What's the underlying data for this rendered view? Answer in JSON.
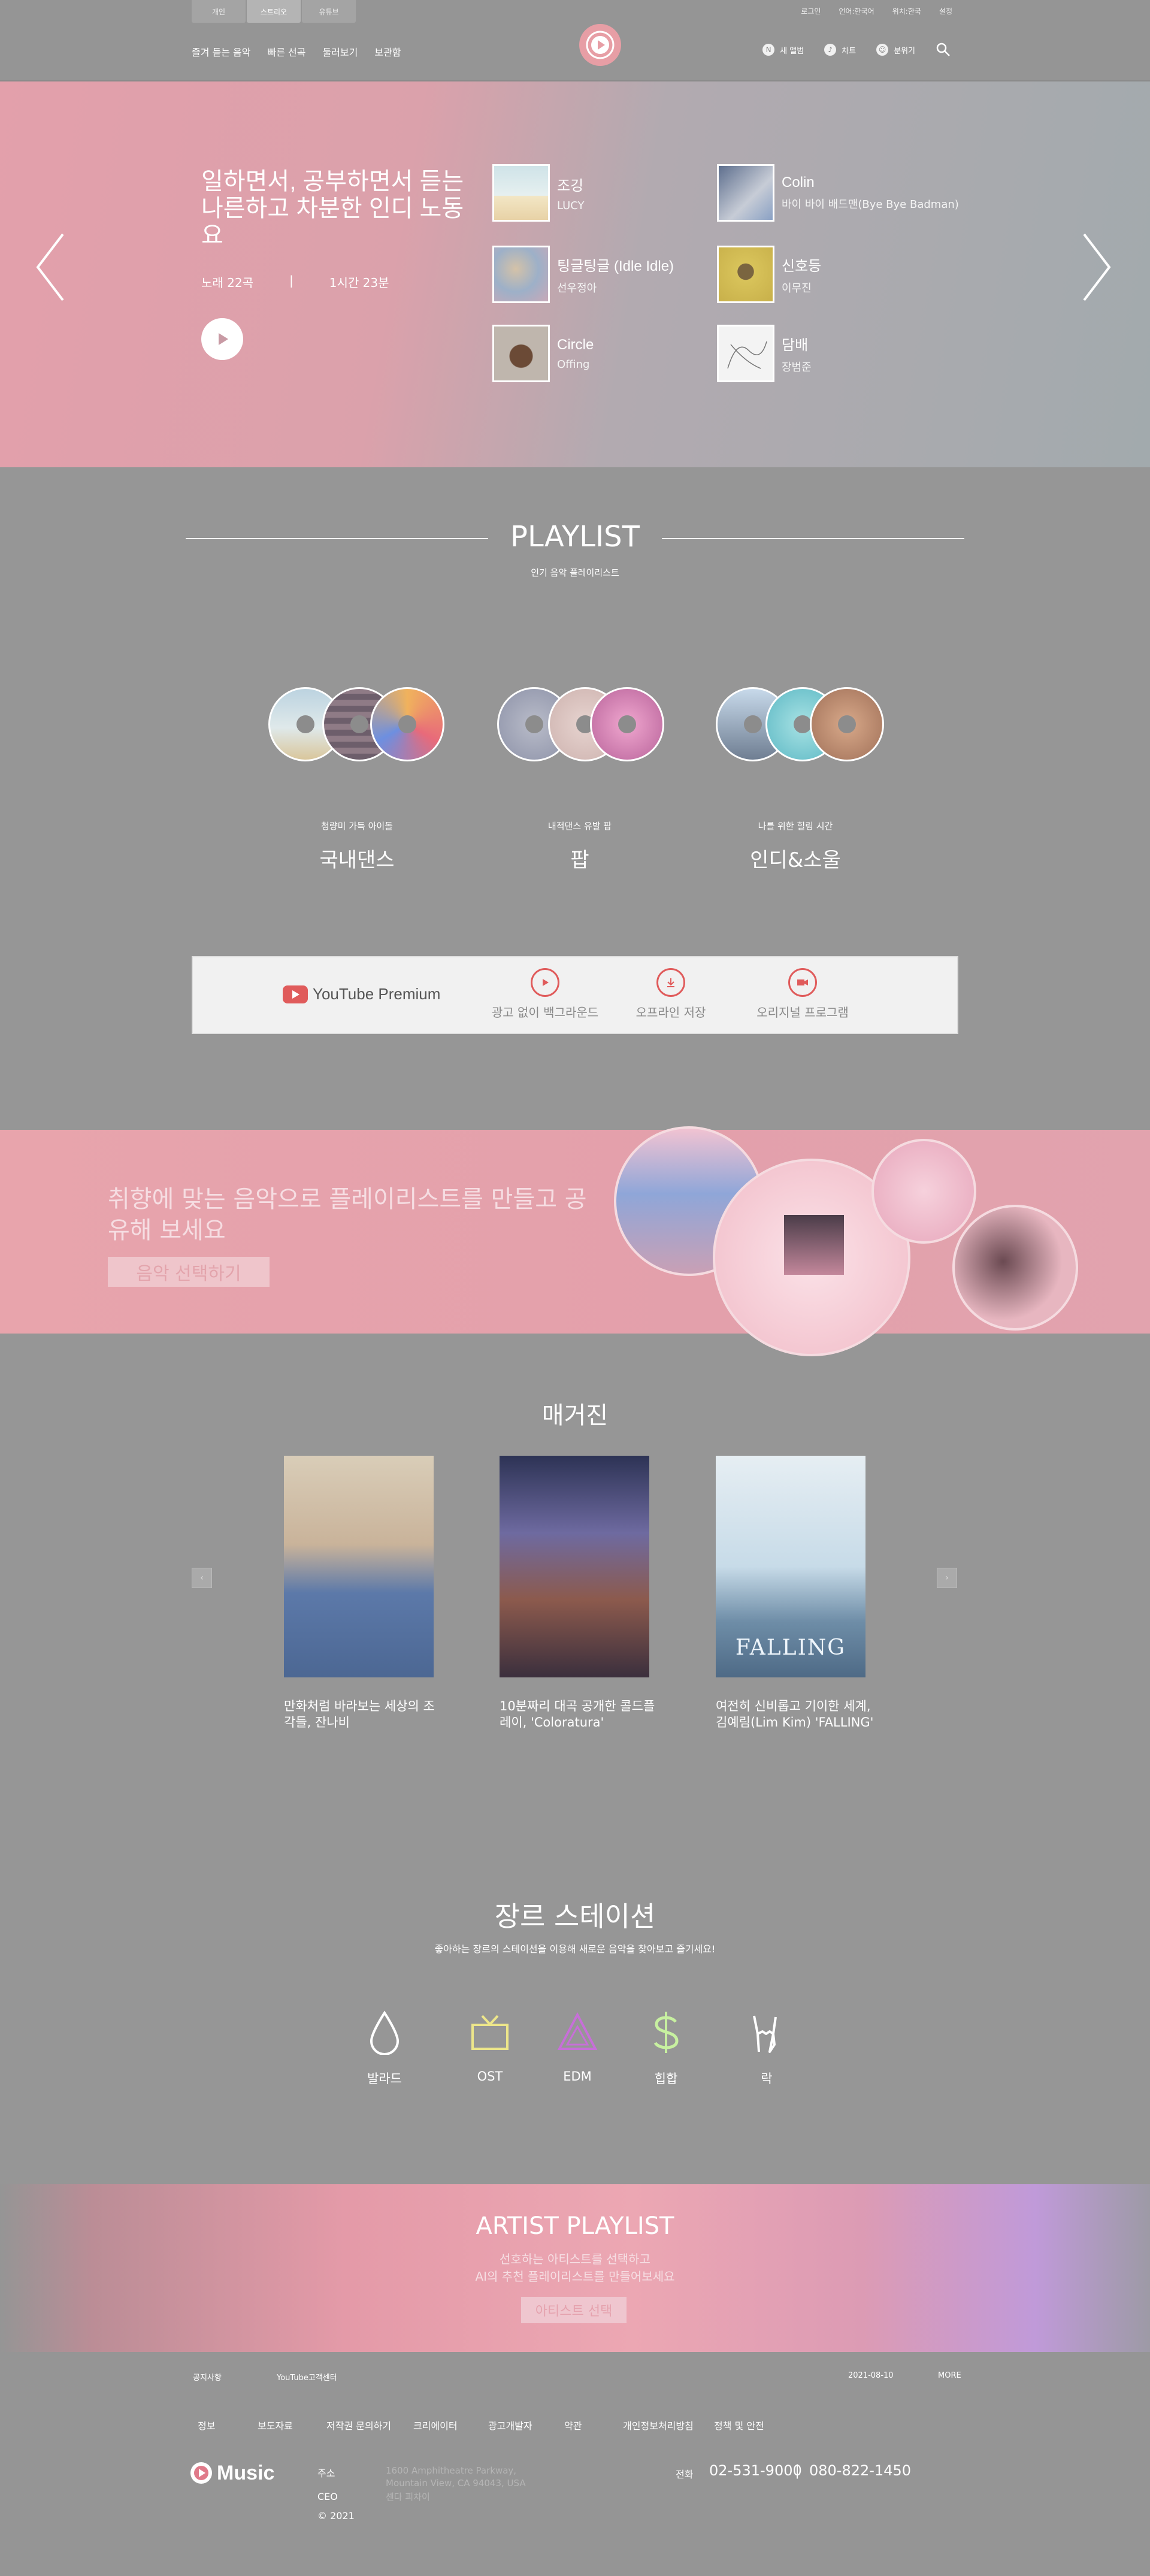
{
  "header": {
    "tabs": [
      "개인",
      "스트리오",
      "유튜브"
    ],
    "utility": [
      "로그인",
      "언어:한국어",
      "위치:한국",
      "설정"
    ],
    "nav": [
      "즐겨 듣는 음악",
      "빠른 선곡",
      "둘러보기",
      "보관함"
    ],
    "right": [
      {
        "icon": "N",
        "label": "새 앨범"
      },
      {
        "icon": "♪",
        "label": "차트"
      },
      {
        "icon": "☺",
        "label": "분위기"
      }
    ]
  },
  "hero": {
    "title": "일하면서, 공부하면서 듣는 나른하고 차분한 인디 노동요",
    "songs": "노래 22곡",
    "separator": "|",
    "duration": "1시간 23분",
    "tracks": [
      {
        "title": "조깅",
        "artist": "LUCY"
      },
      {
        "title": "Colin",
        "artist": "바이 바이 배드맨(Bye Bye Badman)"
      },
      {
        "title": "팅글팅글 (Idle Idle)",
        "artist": "선우정아"
      },
      {
        "title": "신호등",
        "artist": "이무진"
      },
      {
        "title": "Circle",
        "artist": "Offing"
      },
      {
        "title": "담배",
        "artist": "장범준"
      }
    ]
  },
  "playlist": {
    "title": "PLAYLIST",
    "subtitle": "인기 음악 플레이리스트",
    "items": [
      {
        "caption": "청량미 가득 아이돌",
        "name": "국내댄스"
      },
      {
        "caption": "내적댄스 유발 팝",
        "name": "팝"
      },
      {
        "caption": "나를 위한 힐링 시간",
        "name": "인디&소울"
      }
    ]
  },
  "youtube": {
    "logo_text": "YouTube Premium",
    "items": [
      "광고 없이 백그라운드",
      "오프라인 저장",
      "오리지널 프로그램"
    ]
  },
  "create": {
    "title": "취향에 맞는 음악으로 플레이리스트를 만들고 공유해 보세요",
    "button": "음악 선택하기"
  },
  "magazine": {
    "title": "매거진",
    "prev": "‹",
    "next": "›",
    "items": [
      {
        "caption": "만화처럼 바라보는 세상의 조각들, 잔나비"
      },
      {
        "caption": "10분짜리 대곡 공개한 콜드플레이, 'Coloratura'"
      },
      {
        "caption": "여전히 신비롭고 기이한 세계, 김예림(Lim Kim) 'FALLING'"
      }
    ],
    "cover3_text": "FALLING"
  },
  "genre": {
    "title": "장르 스테이션",
    "subtitle": "좋아하는 장르의 스테이션을 이용해 새로운 음악을 찾아보고 즐기세요!",
    "items": [
      {
        "label": "발라드",
        "icon": "drop-icon"
      },
      {
        "label": "OST",
        "icon": "tv-icon"
      },
      {
        "label": "EDM",
        "icon": "triangle-icon"
      },
      {
        "label": "힙합",
        "icon": "dollar-icon"
      },
      {
        "label": "락",
        "icon": "rock-hand-icon"
      }
    ]
  },
  "artist": {
    "title": "ARTIST PLAYLIST",
    "line1": "선호하는 아티스트를 선택하고",
    "line2": "AI의 추천 플레이리스트를 만들어보세요",
    "button": "아티스트 선택"
  },
  "footer": {
    "notice_label": "공지사항",
    "notice_text": "YouTube고객센터",
    "date": "2021-08-10",
    "more": "MORE",
    "links": [
      "정보",
      "보도자료",
      "저작권 문의하기",
      "크리에이터",
      "광고개발자",
      "약관",
      "개인정보처리방침",
      "정책 및 안전"
    ],
    "brand": "Music",
    "address_label": "주소",
    "address": [
      "1600 Amphitheatre Parkway,",
      "Mountain View, CA 94043, USA",
      "센다 피차이"
    ],
    "ceo_label": "CEO",
    "copyright": "© 2021",
    "phone_label": "전화",
    "phone1": "02-531-9000",
    "phone2": "080-822-1450"
  },
  "colors": {
    "accent": "#e3a0ab",
    "background": "#969696",
    "youtube_red": "#e05b5b"
  }
}
